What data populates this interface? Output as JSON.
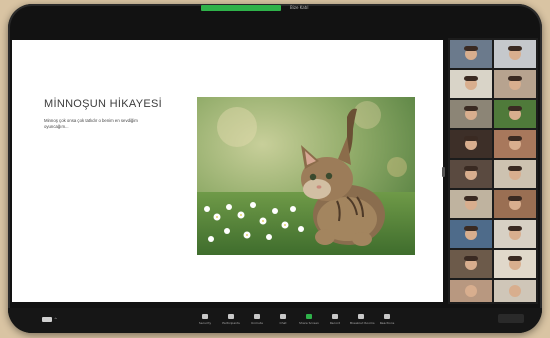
{
  "meeting": {
    "top_label": "Bize Katıl"
  },
  "slide": {
    "title": "MİNNOŞUN HİKAYESİ",
    "body": "Minnoş çok onsa çok tatlıdır o benim en sevdiğim oyuncağım..."
  },
  "toolbar": {
    "buttons": [
      "Unmute",
      "Stop Video",
      "Security",
      "Participants",
      "Chat",
      "Share Screen",
      "Record",
      "Breakout Rooms",
      "Reactions"
    ]
  },
  "gallery": {
    "tile_count": 22
  }
}
